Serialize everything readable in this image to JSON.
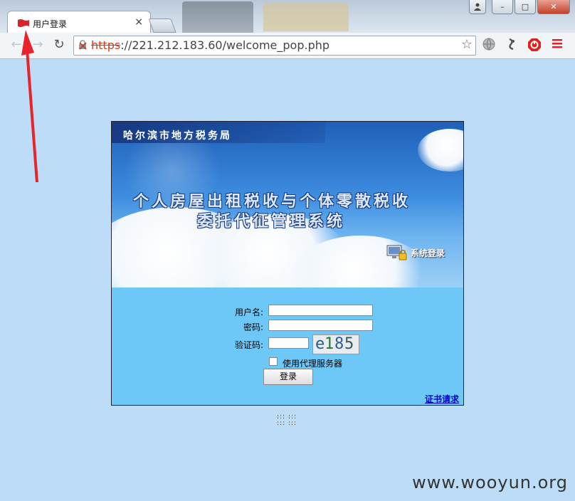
{
  "browser": {
    "tab_title": "用户登录",
    "tab_close": "×",
    "url_protocol": "https",
    "url_rest": "://221.212.183.60/welcome_pop.php",
    "window_buttons": {
      "minimize": "–",
      "maximize": "□",
      "close": "✕"
    },
    "colors": {
      "accent_red": "#c8401f",
      "chrome_bg": "#cfdbe8"
    }
  },
  "page": {
    "bureau": "哈尔滨市地方税务局",
    "system_title_line1": "个人房屋出租税收与个体零散税收",
    "system_title_line2": "委托代征管理系统",
    "system_login_tag": "系统登录",
    "form": {
      "username_label": "用户名:",
      "password_label": "密码:",
      "captcha_label": "验证码:",
      "captcha_text": [
        "e",
        "1",
        "8",
        "5"
      ],
      "proxy_label": "使用代理服务器",
      "proxy_checked": false,
      "login_button": "登录",
      "cert_link": "证书请求"
    },
    "footer_dots_1": "::: :::",
    "footer_dots_2": "::: :::",
    "colors": {
      "page_bg": "#bcdcf7",
      "login_bg": "#6ec8f7",
      "link": "#0000cc"
    }
  },
  "watermark": "www.wooyun.org"
}
